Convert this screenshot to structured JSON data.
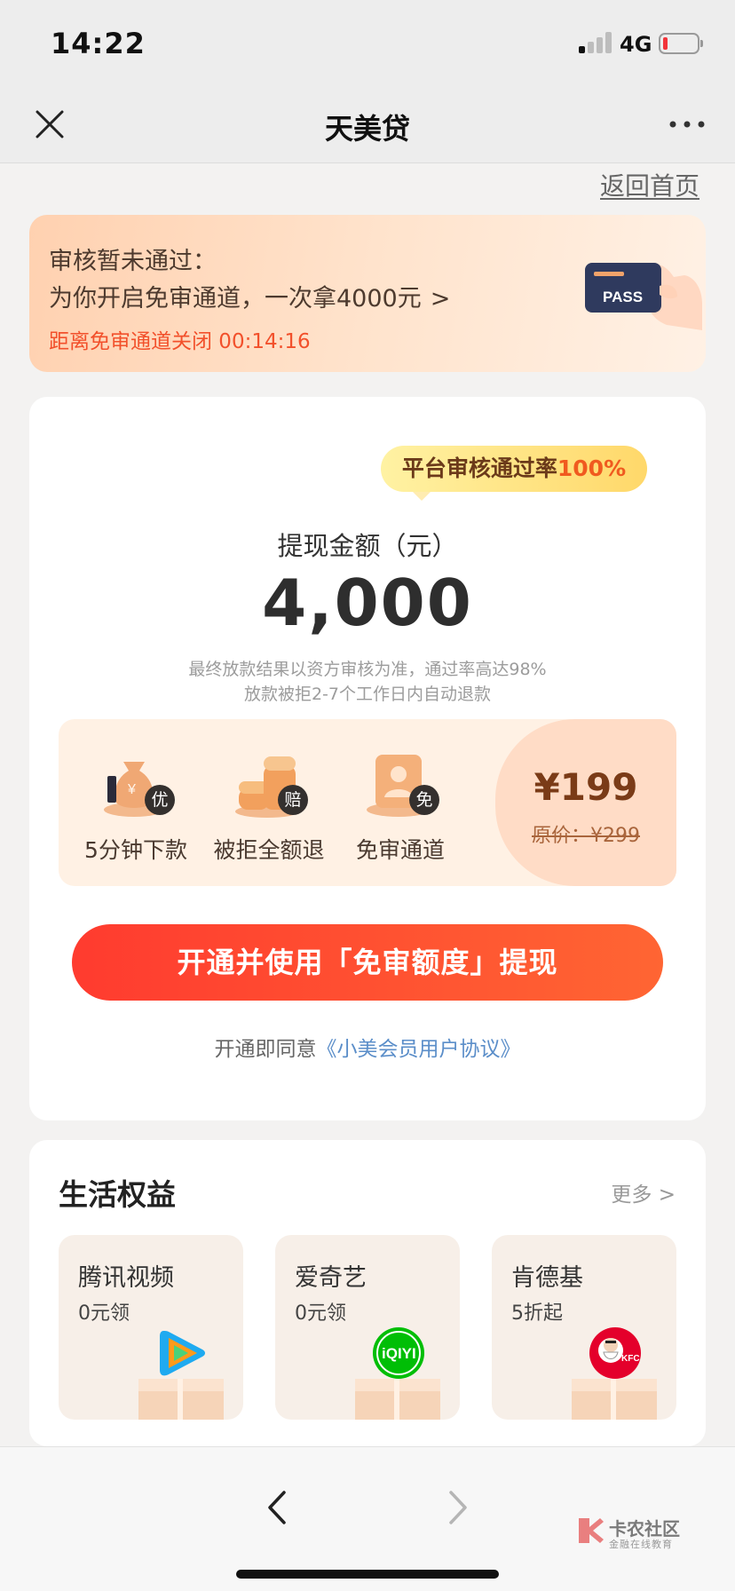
{
  "status": {
    "time": "14:22",
    "network": "4G"
  },
  "nav": {
    "title": "天美贷"
  },
  "back_home": "返回首页",
  "notice": {
    "line1": "审核暂未通过：",
    "line2": "为你开启免审通道，一次拿4000元",
    "line2_arrow": ">",
    "timer": "距离免审通道关闭 00:14:16",
    "pass_text": "PASS"
  },
  "main": {
    "rate_prefix": "平台审核通过率",
    "rate_value": "100%",
    "amount_label": "提现金额（元）",
    "amount_value": "4,000",
    "note1": "最终放款结果以资方审核为准，通过率高达98%",
    "note2": "放款被拒2-7个工作日内自动退款",
    "benefits": [
      {
        "label": "5分钟下款",
        "badge": "优",
        "icon": "money-bag-icon"
      },
      {
        "label": "被拒全额退",
        "badge": "赔",
        "icon": "coin-stack-icon"
      },
      {
        "label": "免审通道",
        "badge": "免",
        "icon": "profile-card-icon"
      }
    ],
    "price_now": "¥199",
    "price_original": "原价：¥299",
    "cta_label": "开通并使用「免审额度」提现",
    "agree_prefix": "开通即同意",
    "agree_link": "《小美会员用户协议》"
  },
  "life": {
    "title": "生活权益",
    "more": "更多 >",
    "items": [
      {
        "name": "腾讯视频",
        "sub": "0元领",
        "icon": "tencent-video-icon"
      },
      {
        "name": "爱奇艺",
        "sub": "0元领",
        "icon": "iqiyi-icon"
      },
      {
        "name": "肯德基",
        "sub": "5折起",
        "icon": "kfc-icon"
      }
    ]
  },
  "watermark": {
    "name": "卡农社区",
    "sub": "金融在线教育"
  },
  "colors": {
    "accent": "#ff3b2f",
    "link": "#5b8ec9",
    "timer": "#f2502b"
  }
}
